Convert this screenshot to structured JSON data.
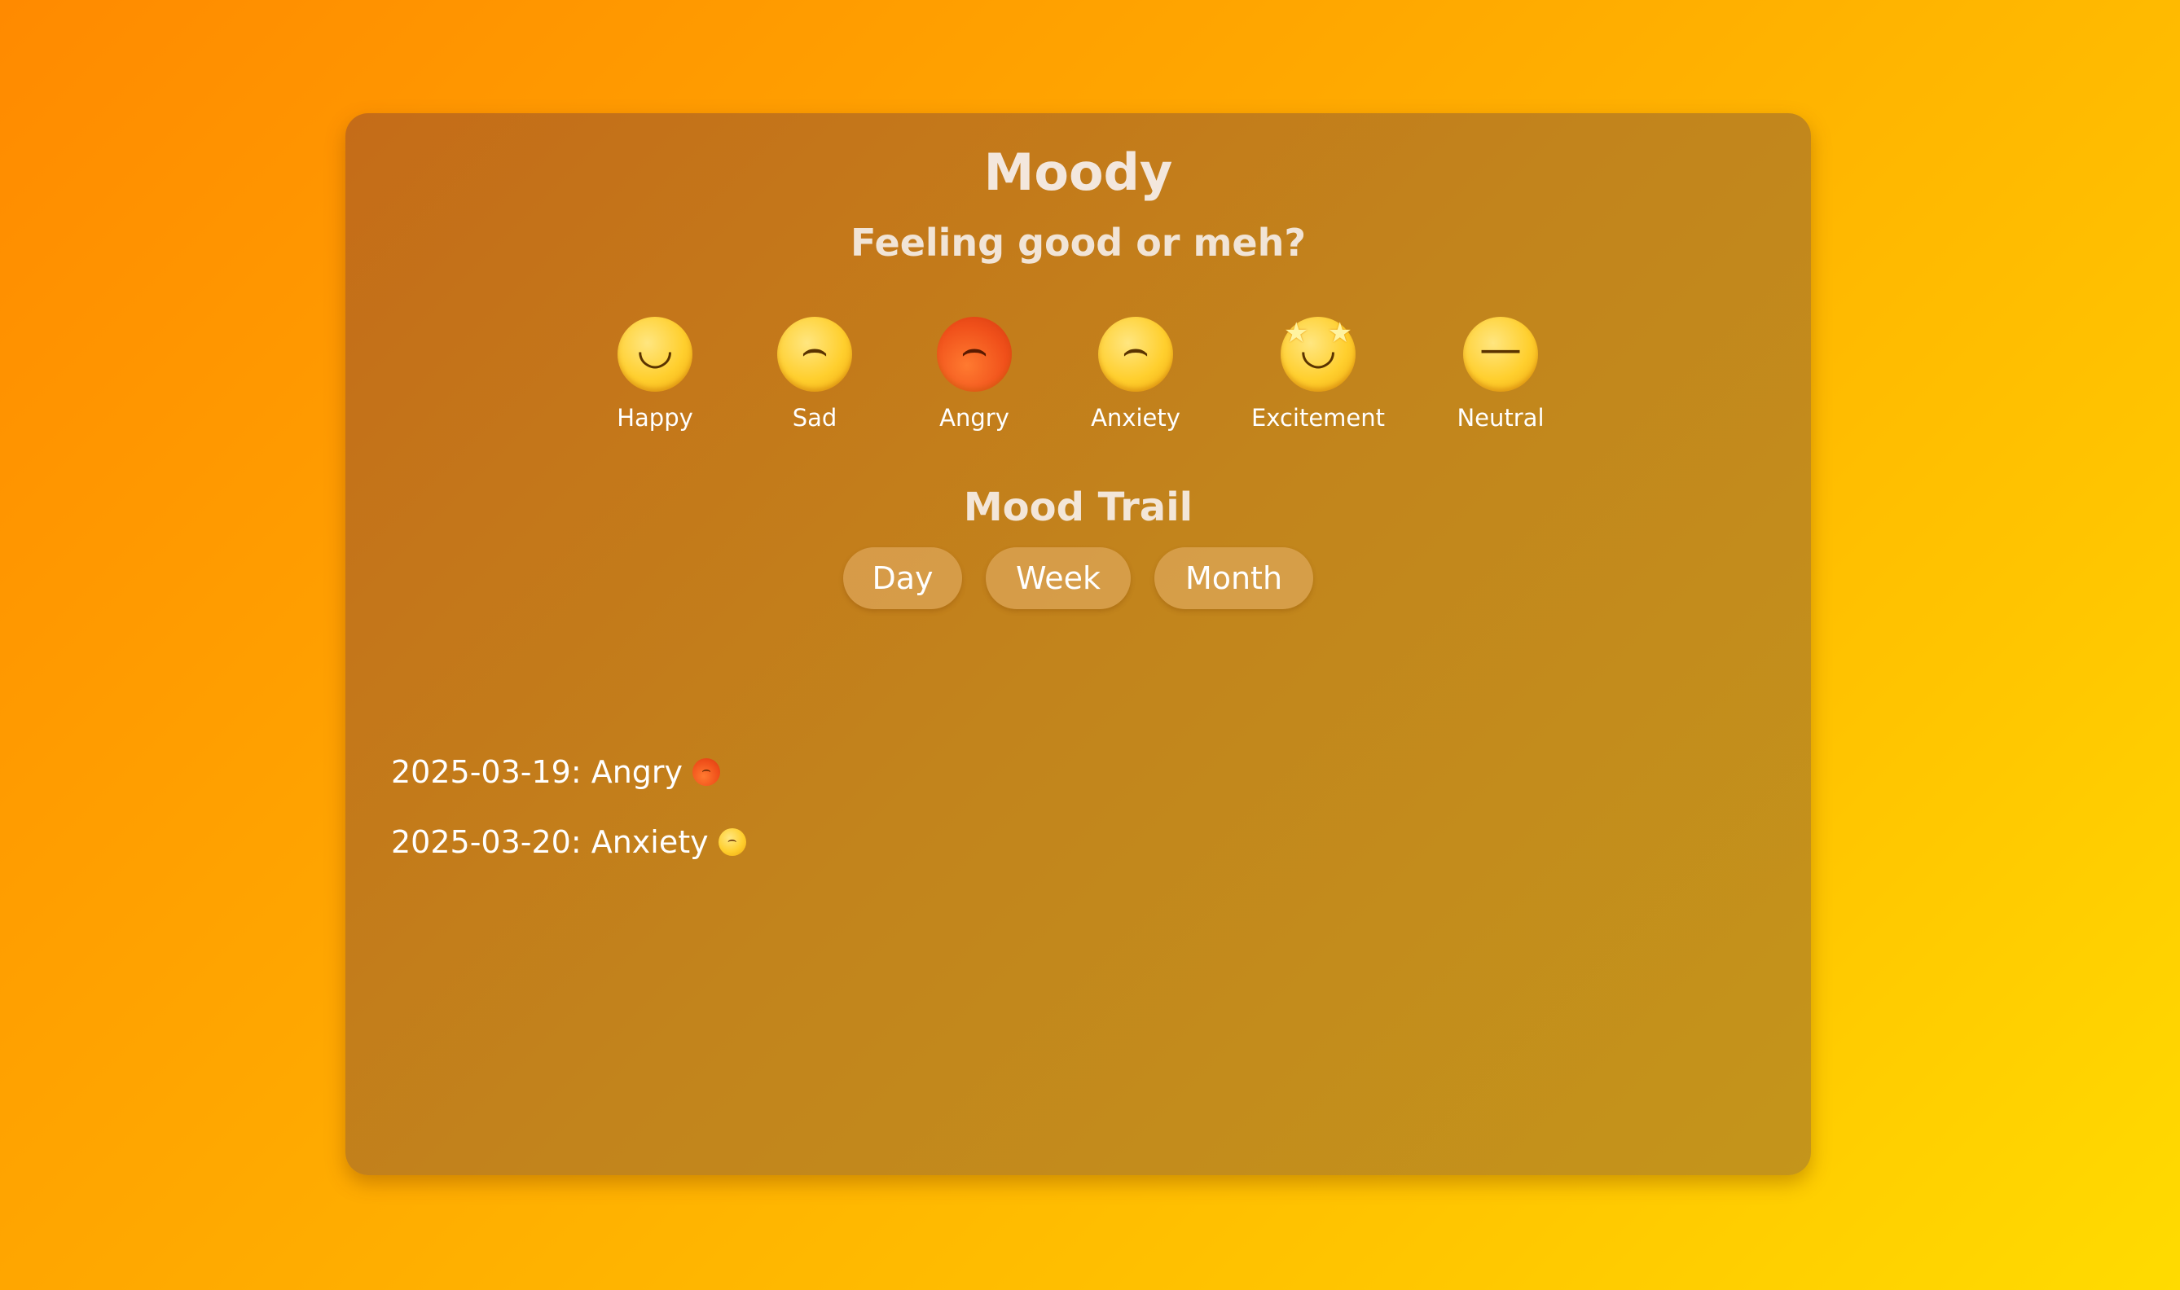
{
  "app": {
    "title": "Moody",
    "subtitle": "Feeling good or meh?"
  },
  "moods": [
    {
      "label": "Happy",
      "icon": "grinning-face-icon",
      "glyph": "◡"
    },
    {
      "label": "Sad",
      "icon": "slightly-frowning-face-icon",
      "glyph": "⌢"
    },
    {
      "label": "Angry",
      "icon": "angry-face-icon",
      "glyph": "⌢"
    },
    {
      "label": "Anxiety",
      "icon": "worried-face-icon",
      "glyph": "⌢"
    },
    {
      "label": "Excitement",
      "icon": "star-struck-face-icon",
      "glyph": "◡"
    },
    {
      "label": "Neutral",
      "icon": "neutral-face-icon",
      "glyph": "—"
    }
  ],
  "trail": {
    "title": "Mood Trail",
    "filters": [
      "Day",
      "Week",
      "Month"
    ],
    "entries": [
      {
        "text": "2025-03-19: Angry",
        "icon": "angry-face-icon"
      },
      {
        "text": "2025-03-20: Anxiety",
        "icon": "worried-face-icon"
      }
    ]
  },
  "colors": {
    "background_start": "#ff8a00",
    "background_end": "#ffdb00",
    "card": "#c2841c",
    "text": "#ffffff"
  }
}
